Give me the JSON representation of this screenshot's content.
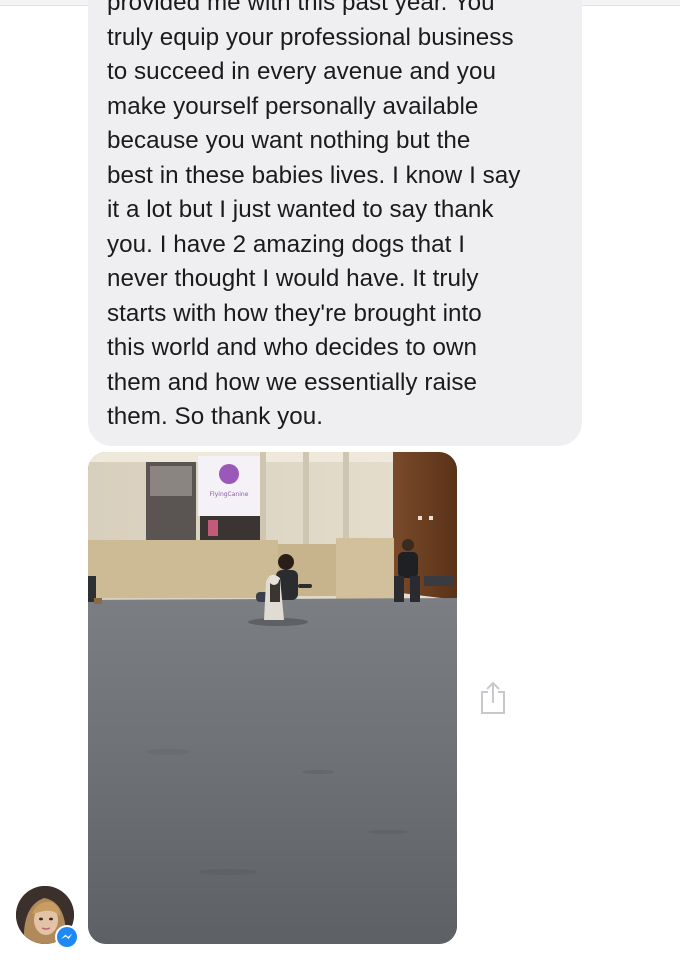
{
  "conversation": {
    "message_lines": [
      "provided me with this past year. You",
      "truly equip your professional business",
      "to succeed in every avenue and you",
      "make yourself personally available",
      "because you want nothing but the",
      "best in these babies lives. I know I say",
      "it a lot but I just wanted to say thank",
      "you. I have 2 amazing dogs that I",
      "never thought I would have. It truly",
      "starts with how they're brought into",
      "this world and who decides to own",
      "them and how we essentially raise",
      "them. So thank you."
    ],
    "photo": {
      "sign_text": "FlyingCanine"
    }
  },
  "icons": {
    "share": "share-icon",
    "messenger": "messenger-icon"
  },
  "colors": {
    "bubble_background": "#efeff2",
    "text": "#1b1b1b",
    "messenger_blue": "#1e88f5"
  }
}
